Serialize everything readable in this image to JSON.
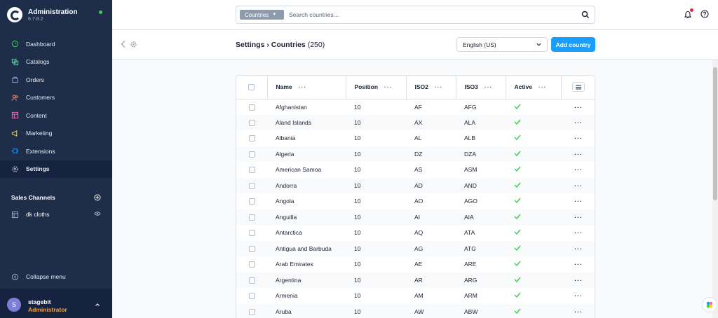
{
  "brand": {
    "title": "Administration",
    "version": "6.7.8.2"
  },
  "nav": [
    {
      "label": "Dashboard",
      "icon": "dashboard-icon",
      "color": "#37d046",
      "active": false
    },
    {
      "label": "Catalogs",
      "icon": "catalogs-icon",
      "color": "#57d9a3",
      "active": false
    },
    {
      "label": "Orders",
      "icon": "orders-icon",
      "color": "#a092f0",
      "active": false
    },
    {
      "label": "Customers",
      "icon": "customers-icon",
      "color": "#f88962",
      "active": false
    },
    {
      "label": "Content",
      "icon": "content-icon",
      "color": "#ff68b4",
      "active": false
    },
    {
      "label": "Marketing",
      "icon": "marketing-icon",
      "color": "#ffd700",
      "active": false
    },
    {
      "label": "Extensions",
      "icon": "extensions-icon",
      "color": "#189eff",
      "active": false
    },
    {
      "label": "Settings",
      "icon": "settings-icon",
      "color": "#a8b3c7",
      "active": true
    }
  ],
  "sales_channels": {
    "title": "Sales Channels",
    "items": [
      {
        "label": "dk cloths"
      }
    ]
  },
  "collapse_label": "Collapse menu",
  "user": {
    "initial": "S",
    "name": "stagebit",
    "role": "Administrator"
  },
  "search": {
    "scope": "Countries",
    "placeholder": "Search countries..."
  },
  "header": {
    "title": "Settings",
    "subtitle": "Countries",
    "count": "(250)",
    "language": "English (US)",
    "add_label": "Add country"
  },
  "grid": {
    "columns": [
      "Name",
      "Position",
      "ISO2",
      "ISO3",
      "Active"
    ],
    "rows": [
      {
        "name": "Afghanistan",
        "position": "10",
        "iso2": "AF",
        "iso3": "AFG"
      },
      {
        "name": "Aland Islands",
        "position": "10",
        "iso2": "AX",
        "iso3": "ALA"
      },
      {
        "name": "Albania",
        "position": "10",
        "iso2": "AL",
        "iso3": "ALB"
      },
      {
        "name": "Algeria",
        "position": "10",
        "iso2": "DZ",
        "iso3": "DZA"
      },
      {
        "name": "American Samoa",
        "position": "10",
        "iso2": "AS",
        "iso3": "ASM"
      },
      {
        "name": "Andorra",
        "position": "10",
        "iso2": "AD",
        "iso3": "AND"
      },
      {
        "name": "Angola",
        "position": "10",
        "iso2": "AO",
        "iso3": "AGO"
      },
      {
        "name": "Anguilla",
        "position": "10",
        "iso2": "AI",
        "iso3": "AIA"
      },
      {
        "name": "Antarctica",
        "position": "10",
        "iso2": "AQ",
        "iso3": "ATA"
      },
      {
        "name": "Antigua and Barbuda",
        "position": "10",
        "iso2": "AG",
        "iso3": "ATG"
      },
      {
        "name": "Arab Emirates",
        "position": "10",
        "iso2": "AE",
        "iso3": "ARE"
      },
      {
        "name": "Argentina",
        "position": "10",
        "iso2": "AR",
        "iso3": "ARG"
      },
      {
        "name": "Armenia",
        "position": "10",
        "iso2": "AM",
        "iso3": "ARM"
      },
      {
        "name": "Aruba",
        "position": "10",
        "iso2": "AW",
        "iso3": "ABW"
      }
    ]
  },
  "colors": {
    "sidebar": "#1e2d4a",
    "accent": "#189eff",
    "active_check": "#37d046",
    "role": "#ff9f2d"
  }
}
